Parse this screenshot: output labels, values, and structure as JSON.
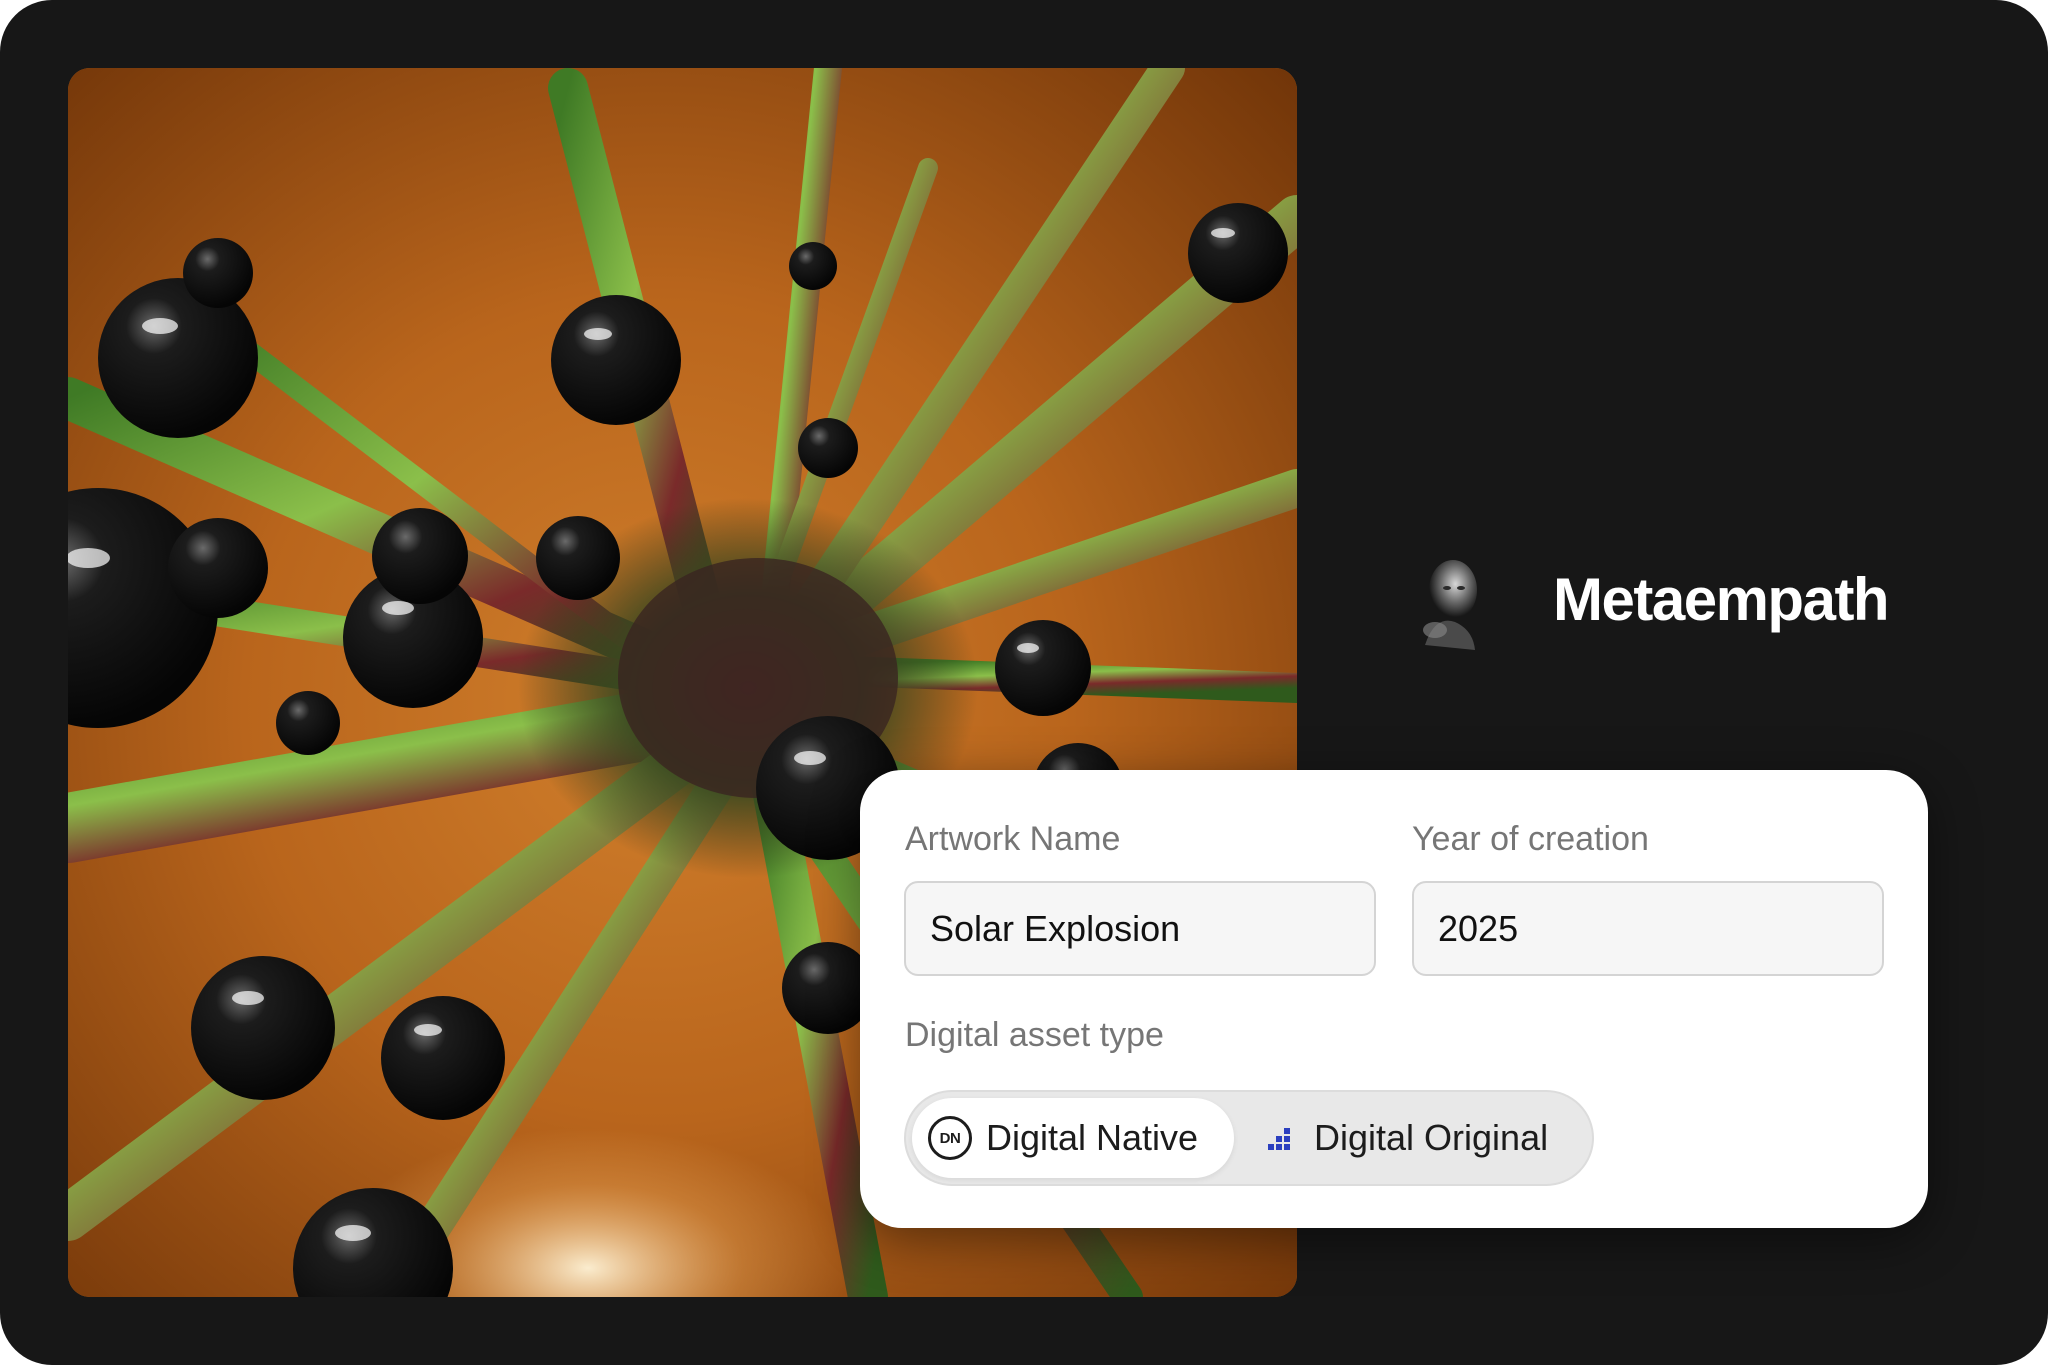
{
  "artist": {
    "name": "Metaempath"
  },
  "form": {
    "artwork_name": {
      "label": "Artwork Name",
      "value": "Solar Explosion"
    },
    "year_of_creation": {
      "label": "Year of creation",
      "value": "2025"
    },
    "asset_type": {
      "label": "Digital asset type",
      "options": [
        {
          "icon_text": "DN",
          "label": "Digital Native",
          "icon": "dn-badge-icon",
          "selected": true
        },
        {
          "label": "Digital Original",
          "icon": "pixel-bars-icon",
          "selected": false
        }
      ]
    }
  },
  "colors": {
    "background": "#171717",
    "card": "#ffffff",
    "artwork_base": "#b8661c",
    "selected_option": "#ffffff",
    "toggle_track": "#e8e8e8",
    "digital_original_icon": "#2b3fbf"
  }
}
